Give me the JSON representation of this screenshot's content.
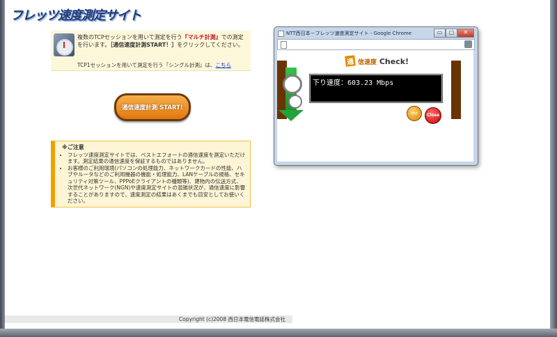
{
  "header": {
    "logo_text": "フレッツ速度測定サイト"
  },
  "info": {
    "text_before": "複数のTCPセッションを用いて測定を行う",
    "multi_label": "『マルチ計測』",
    "text_mid": "での測定を行います。",
    "start_quote": "［通信速度計測START！］",
    "text_after": "をクリックしてください。",
    "single_text": "TCP1セッションを用いて測定を行う『シングル計測』は、",
    "single_link": "こちら"
  },
  "start_button": {
    "label": "通信速度計測 START!"
  },
  "caution": {
    "title": "※ご注意",
    "items": [
      "フレッツ速度測定サイトでは、ベストエフォートの通信速度を測定いただけます。測定結果の通信速度を保証するものではありません。",
      "お客様のご利用環境(パソコンの処理能力、ネットワークカードの性能、ハブやルータなどのご利用機器の機能・処理能力、LANケーブルの規格、セキュリティ対策ツール、PPPoEクライアントの種類等)、建物内の伝送方式、次世代ネットワーク(NGN)や速度測定サイトの混雑状況が、通信速度に影響することがありますので、速度測定の結果はあくまでも目安としてお使いください。"
    ]
  },
  "footer": {
    "copyright": "Copyright (c)2008 西日本電信電話株式会社"
  },
  "popup": {
    "window_title": "NTT西日本－フレッツ速度測定サイト - Google Chrome",
    "check_mark": "通",
    "check_jp": "信速度",
    "check_en": "Check!",
    "speed_text": "下り速度：603.23 Mbps",
    "test_label": "test",
    "close_label": "Close",
    "minimize": "▭",
    "maximize": "▢",
    "close_win": "✕"
  }
}
